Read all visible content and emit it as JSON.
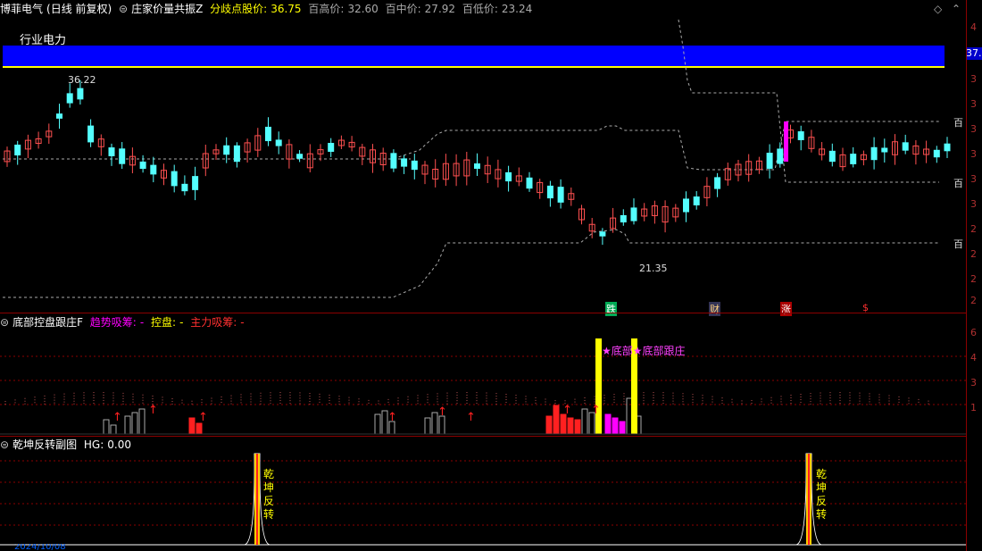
{
  "main_header": {
    "stock_name": "博菲电气",
    "period": "(日线 前复权)",
    "indicator": "庄家价量共振Z",
    "divergence_label": "分歧点股价:",
    "divergence_value": "36.75",
    "high_label": "百高价:",
    "high_value": "32.60",
    "mid_label": "百中价:",
    "mid_value": "27.92",
    "low_label": "百低价:",
    "low_value": "23.24"
  },
  "industry_label": "行业电力",
  "price_high_annotation": "36.22",
  "price_low_annotation": "21.35",
  "right_price_tag": "37.",
  "right_labels": [
    "百",
    "百",
    "百"
  ],
  "event_labels": [
    "跌",
    "财",
    "涨",
    "$"
  ],
  "sub1_header": {
    "title": "底部控盘跟庄F",
    "trend_label": "趋势吸筹:",
    "trend_value": "-",
    "control_label": "控盘:",
    "control_value": "-",
    "main_label": "主力吸筹:",
    "main_value": "-"
  },
  "sub1_annotation": "★底部★底部跟庄",
  "sub2_header": {
    "title": "乾坤反转副图",
    "hg_label": "HG:",
    "hg_value": "0.00"
  },
  "sub2_signal": [
    "乾",
    "坤",
    "反",
    "转"
  ],
  "sub2_footer_text": "2024/10/08",
  "y_axis_ticks_main": [
    "4",
    "3",
    "3",
    "3",
    "3",
    "3",
    "3",
    "2",
    "2",
    "2",
    "2"
  ],
  "y_axis_ticks_sub1": [
    "6",
    "4",
    "3",
    "1"
  ],
  "colors": {
    "up": "#ff5050",
    "down": "#54ffff",
    "blue_band": "#0000ff",
    "yellow": "#ffff00",
    "magenta": "#ff00ff"
  }
}
